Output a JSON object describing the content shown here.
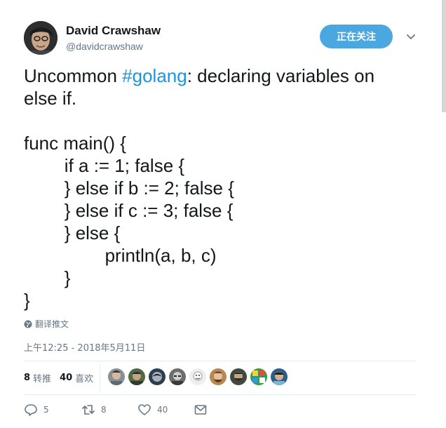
{
  "author": {
    "name": "David Crawshaw",
    "handle": "@davidcrawshaw"
  },
  "follow_button_label": "正在关注",
  "tweet": {
    "lines": [
      {
        "pre": "Uncommon ",
        "hashtag": "#golang",
        "post": ": declaring variables on"
      },
      "else if.",
      "",
      "func main() {",
      "        if a := 1; false {",
      "        } else if b := 2; false {",
      "        } else if c := 3; false {",
      "        } else {",
      "                println(a, b, c)",
      "        }",
      "}"
    ]
  },
  "translate_label": "翻译推文",
  "timestamp": "上午12:25 - 2018年5月11日",
  "stats": {
    "retweets_count": "8",
    "retweets_label": "转推",
    "likes_count": "40",
    "likes_label": "喜欢"
  },
  "liker_avatar_count_shown": 9,
  "actions": {
    "reply_count": "5",
    "retweet_count": "8",
    "like_count": "40"
  },
  "colors": {
    "accent": "#1b95e0",
    "follow_button": "#4aa7e0",
    "secondary_text": "#657786"
  },
  "icons": [
    "chevron-down-icon",
    "globe-icon",
    "reply-icon",
    "retweet-icon",
    "heart-icon",
    "envelope-icon"
  ]
}
